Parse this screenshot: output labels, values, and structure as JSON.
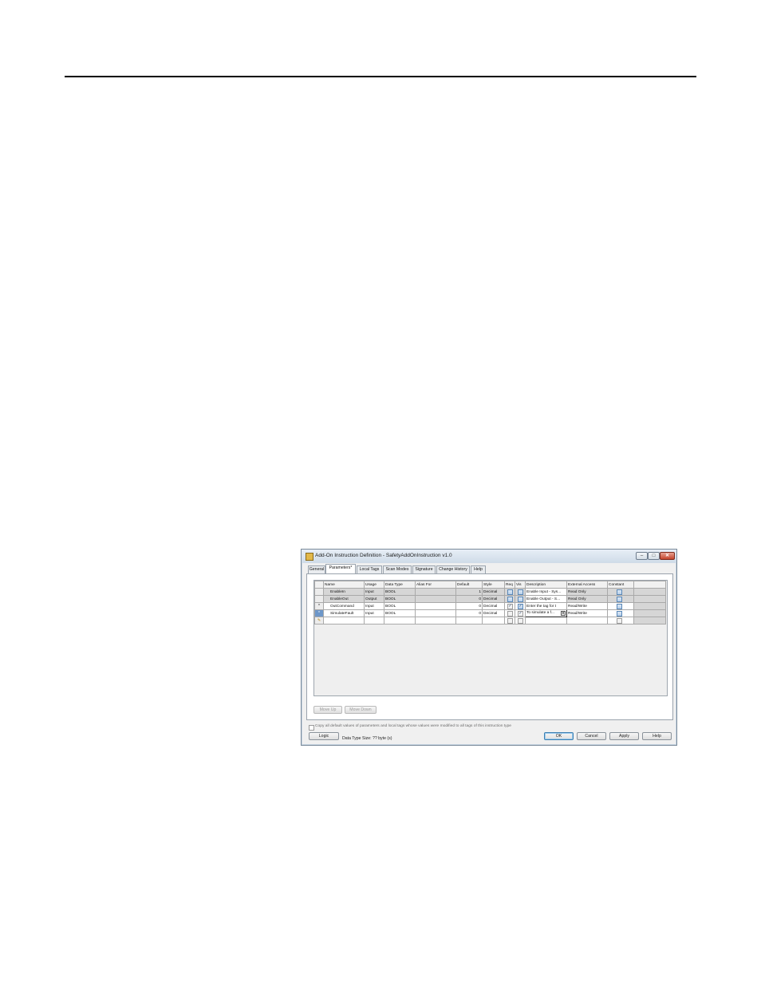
{
  "window": {
    "title": "Add-On Instruction Definition - SafetyAddOnInstruction v1.0",
    "controls": {
      "minimize": "–",
      "maximize": "□",
      "close": "✕"
    }
  },
  "tabs": [
    "General",
    "Parameters*",
    "Local Tags",
    "Scan Modes",
    "Signature",
    "Change History",
    "Help"
  ],
  "active_tab": "Parameters*",
  "table": {
    "columns": [
      "Name",
      "Usage",
      "Data Type",
      "Alias For",
      "Default",
      "Style",
      "Req",
      "Vis",
      "Description",
      "External Access",
      "Constant"
    ],
    "rows": [
      {
        "marker": "",
        "name": "EnableIn",
        "usage": "Input",
        "data_type": "BOOL",
        "alias_for": "",
        "default": "1",
        "style": "Decimal",
        "req": false,
        "vis": false,
        "description": "Enable Input - Sys...",
        "external_access": "Read Only",
        "constant": false,
        "shaded": true
      },
      {
        "marker": "",
        "name": "EnableOut",
        "usage": "Output",
        "data_type": "BOOL",
        "alias_for": "",
        "default": "0",
        "style": "Decimal",
        "req": false,
        "vis": false,
        "description": "Enable Output - S...",
        "external_access": "Read Only",
        "constant": false,
        "shaded": true
      },
      {
        "marker": "*",
        "name": "OutCommand",
        "usage": "Input",
        "data_type": "BOOL",
        "alias_for": "",
        "default": "0",
        "style": "Decimal",
        "req": true,
        "vis": true,
        "description": "Enter the tag for t",
        "external_access": "Read/Write",
        "constant": false,
        "shaded": false
      },
      {
        "marker": "*",
        "name": "SimulateFault",
        "usage": "Input",
        "data_type": "BOOL",
        "alias_for": "",
        "default": "0",
        "style": "Decimal",
        "req": false,
        "vis": true,
        "description": "To simulate a f...",
        "external_access": "Read/Write",
        "constant": false,
        "shaded": false
      }
    ],
    "new_row_marker": "✎"
  },
  "buttons": {
    "move_up": "Move Up",
    "move_down": "Move Down",
    "logic": "Logic",
    "ok": "OK",
    "cancel": "Cancel",
    "apply": "Apply",
    "help": "Help"
  },
  "copy_defaults_label": "Copy all default values of parameters and local tags whose values were modified to all tags of this instruction type",
  "data_type_size": "Data Type Size: ?? byte (s)"
}
